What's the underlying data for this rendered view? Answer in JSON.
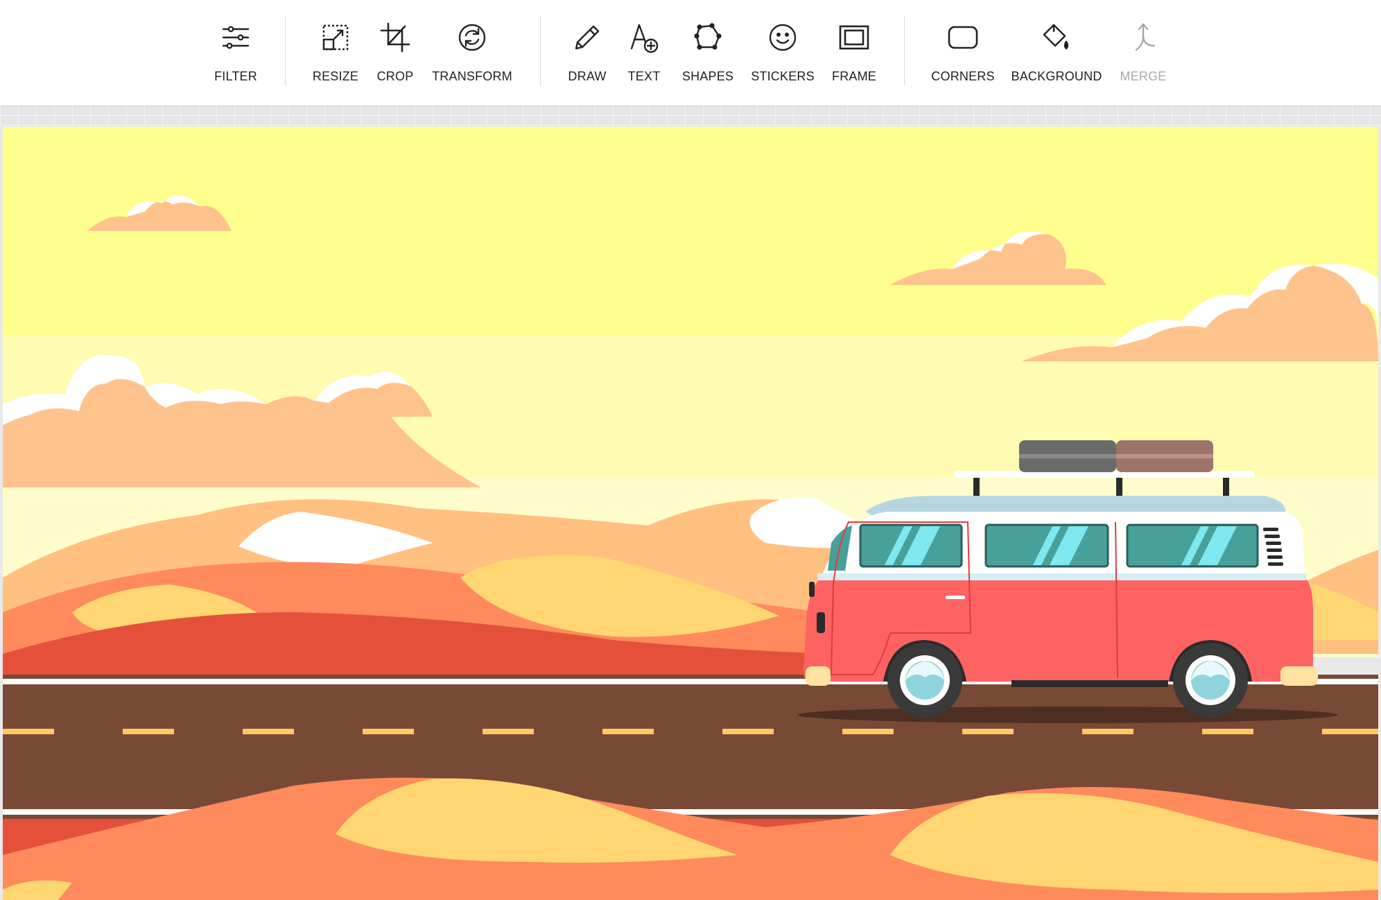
{
  "toolbar": {
    "tools": [
      {
        "id": "filter",
        "label": "FILTER",
        "icon": "sliders-icon"
      },
      {
        "id": "resize",
        "label": "RESIZE",
        "icon": "resize-icon"
      },
      {
        "id": "crop",
        "label": "CROP",
        "icon": "crop-icon"
      },
      {
        "id": "transform",
        "label": "TRANSFORM",
        "icon": "rotate-icon"
      },
      {
        "id": "draw",
        "label": "DRAW",
        "icon": "pencil-icon"
      },
      {
        "id": "text",
        "label": "TEXT",
        "icon": "text-add-icon"
      },
      {
        "id": "shapes",
        "label": "SHAPES",
        "icon": "polygon-icon"
      },
      {
        "id": "stickers",
        "label": "STICKERS",
        "icon": "smiley-icon"
      },
      {
        "id": "frame",
        "label": "FRAME",
        "icon": "frame-icon"
      },
      {
        "id": "corners",
        "label": "CORNERS",
        "icon": "rounded-square-icon"
      },
      {
        "id": "background",
        "label": "BACKGROUND",
        "icon": "paint-bucket-icon"
      },
      {
        "id": "merge",
        "label": "MERGE",
        "icon": "merge-icon",
        "disabled": true
      }
    ]
  },
  "canvas": {
    "image_subject": "desert-road-van-illustration"
  },
  "colors": {
    "sky_top": "#ffff8e",
    "sky_mid": "#fffbb0",
    "sky_low": "#fffccc",
    "cloud": "#fec38d",
    "cloud_highlight": "#ffffff",
    "dune_light": "#ffd672",
    "dune_mid": "#ff8a5c",
    "dune_far": "#ffc080",
    "dune_dark": "#e4503a",
    "road": "#784a36",
    "road_line": "#ffc862",
    "van_body": "#ff6361",
    "van_window": "#48a09b",
    "roof_rack_bag1": "#6b6b6b",
    "roof_rack_bag2": "#9c7468",
    "disabled_text": "#a8a8a8"
  }
}
